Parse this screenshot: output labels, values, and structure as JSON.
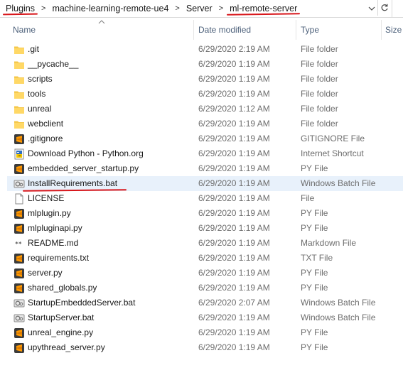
{
  "address_bar": {
    "crumbs": [
      "Plugins",
      "machine-learning-remote-ue4",
      "Server",
      "ml-remote-server"
    ],
    "separator": ">",
    "dropdown_icon": "chevron-down-icon",
    "refresh_icon": "refresh-icon"
  },
  "columns": {
    "name": "Name",
    "date_modified": "Date modified",
    "type": "Type",
    "size": "Size"
  },
  "files": [
    {
      "name": ".git",
      "date": "6/29/2020 2:19 AM",
      "type": "File folder",
      "icon": "folder"
    },
    {
      "name": "__pycache__",
      "date": "6/29/2020 1:19 AM",
      "type": "File folder",
      "icon": "folder"
    },
    {
      "name": "scripts",
      "date": "6/29/2020 1:19 AM",
      "type": "File folder",
      "icon": "folder"
    },
    {
      "name": "tools",
      "date": "6/29/2020 1:19 AM",
      "type": "File folder",
      "icon": "folder"
    },
    {
      "name": "unreal",
      "date": "6/29/2020 1:12 AM",
      "type": "File folder",
      "icon": "folder"
    },
    {
      "name": "webclient",
      "date": "6/29/2020 1:19 AM",
      "type": "File folder",
      "icon": "folder"
    },
    {
      "name": ".gitignore",
      "date": "6/29/2020 1:19 AM",
      "type": "GITIGNORE File",
      "icon": "sublime"
    },
    {
      "name": "Download Python - Python.org",
      "date": "6/29/2020 1:19 AM",
      "type": "Internet Shortcut",
      "icon": "shortcut"
    },
    {
      "name": "embedded_server_startup.py",
      "date": "6/29/2020 1:19 AM",
      "type": "PY File",
      "icon": "sublime"
    },
    {
      "name": "InstallRequirements.bat",
      "date": "6/29/2020 1:19 AM",
      "type": "Windows Batch File",
      "icon": "batch"
    },
    {
      "name": "LICENSE",
      "date": "6/29/2020 1:19 AM",
      "type": "File",
      "icon": "blank"
    },
    {
      "name": "mlplugin.py",
      "date": "6/29/2020 1:19 AM",
      "type": "PY File",
      "icon": "sublime"
    },
    {
      "name": "mlpluginapi.py",
      "date": "6/29/2020 1:19 AM",
      "type": "PY File",
      "icon": "sublime"
    },
    {
      "name": "README.md",
      "date": "6/29/2020 1:19 AM",
      "type": "Markdown File",
      "icon": "markdown"
    },
    {
      "name": "requirements.txt",
      "date": "6/29/2020 1:19 AM",
      "type": "TXT File",
      "icon": "sublime"
    },
    {
      "name": "server.py",
      "date": "6/29/2020 1:19 AM",
      "type": "PY File",
      "icon": "sublime"
    },
    {
      "name": "shared_globals.py",
      "date": "6/29/2020 1:19 AM",
      "type": "PY File",
      "icon": "sublime"
    },
    {
      "name": "StartupEmbeddedServer.bat",
      "date": "6/29/2020 2:07 AM",
      "type": "Windows Batch File",
      "icon": "batch"
    },
    {
      "name": "StartupServer.bat",
      "date": "6/29/2020 1:19 AM",
      "type": "Windows Batch File",
      "icon": "batch"
    },
    {
      "name": "unreal_engine.py",
      "date": "6/29/2020 1:19 AM",
      "type": "PY File",
      "icon": "sublime"
    },
    {
      "name": "upythread_server.py",
      "date": "6/29/2020 1:19 AM",
      "type": "PY File",
      "icon": "sublime"
    }
  ],
  "selected_index": 9,
  "colors": {
    "annotation_red": "#d8161b",
    "selection": "#e8f1fb",
    "folder": "#f5c84c"
  }
}
